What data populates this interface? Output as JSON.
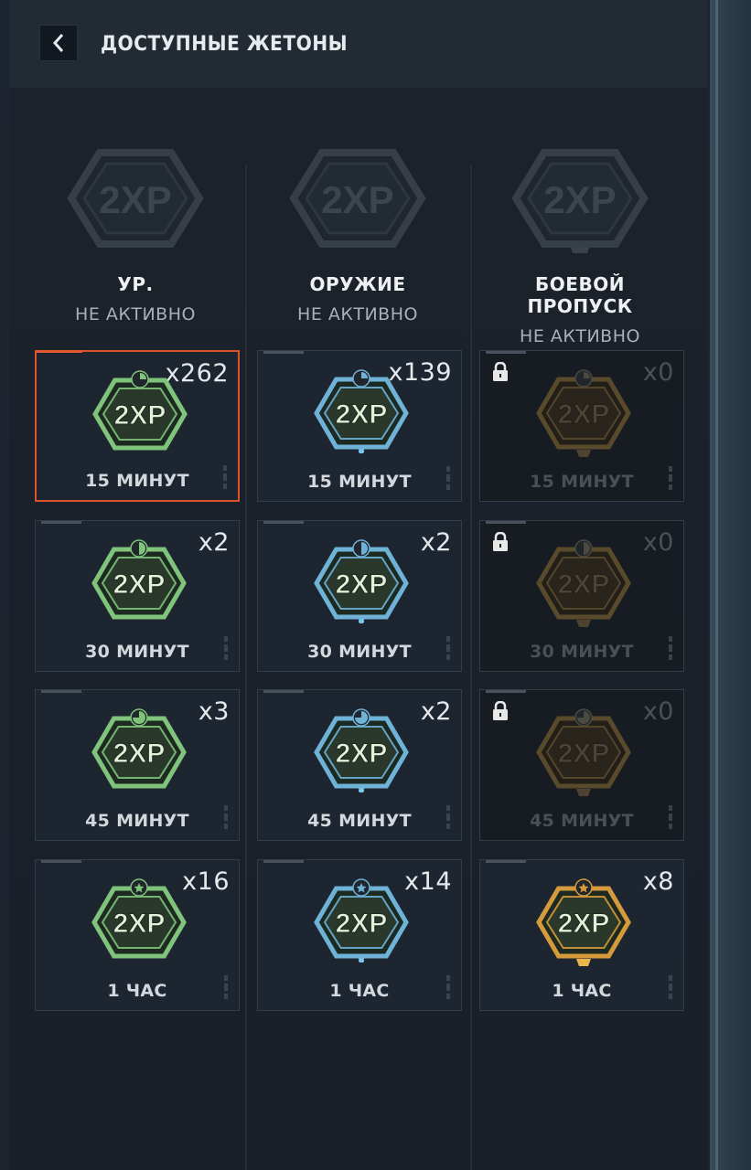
{
  "header": {
    "title": "ДОСТУПНЫЕ ЖЕТОНЫ"
  },
  "categories": [
    {
      "name": "УР.",
      "status": "НЕ АКТИВНО",
      "kind": "level"
    },
    {
      "name": "ОРУЖИЕ",
      "status": "НЕ АКТИВНО",
      "kind": "weapon"
    },
    {
      "name": "БОЕВОЙ ПРОПУСК",
      "status": "НЕ АКТИВНО",
      "kind": "battlepass"
    }
  ],
  "badge_text": "2XP",
  "colors": {
    "level": "#7fc47a",
    "weapon": "#6fb2d8",
    "battlepass": "#d49a3c",
    "selected_border": "#d9542a"
  },
  "tokens": [
    [
      {
        "count": "x262",
        "duration": "15 МИНУТ",
        "locked": false,
        "selected": true,
        "timer": "quarter"
      },
      {
        "count": "x2",
        "duration": "30 МИНУТ",
        "locked": false,
        "selected": false,
        "timer": "half"
      },
      {
        "count": "x3",
        "duration": "45 МИНУТ",
        "locked": false,
        "selected": false,
        "timer": "three-quarter"
      },
      {
        "count": "x16",
        "duration": "1 ЧАС",
        "locked": false,
        "selected": false,
        "timer": "star"
      }
    ],
    [
      {
        "count": "x139",
        "duration": "15 МИНУТ",
        "locked": false,
        "selected": false,
        "timer": "quarter"
      },
      {
        "count": "x2",
        "duration": "30 МИНУТ",
        "locked": false,
        "selected": false,
        "timer": "half"
      },
      {
        "count": "x2",
        "duration": "45 МИНУТ",
        "locked": false,
        "selected": false,
        "timer": "three-quarter"
      },
      {
        "count": "x14",
        "duration": "1 ЧАС",
        "locked": false,
        "selected": false,
        "timer": "star"
      }
    ],
    [
      {
        "count": "x0",
        "duration": "15 МИНУТ",
        "locked": true,
        "selected": false,
        "timer": "quarter"
      },
      {
        "count": "x0",
        "duration": "30 МИНУТ",
        "locked": true,
        "selected": false,
        "timer": "half"
      },
      {
        "count": "x0",
        "duration": "45 МИНУТ",
        "locked": true,
        "selected": false,
        "timer": "three-quarter"
      },
      {
        "count": "x8",
        "duration": "1 ЧАС",
        "locked": false,
        "selected": false,
        "timer": "star"
      }
    ]
  ]
}
